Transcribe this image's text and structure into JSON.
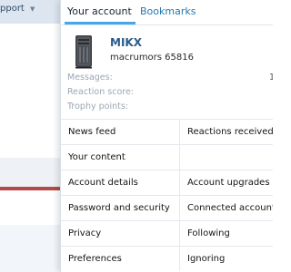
{
  "background": {
    "nav_label": "pport",
    "nav_caret": "▼"
  },
  "tabs": [
    {
      "label": "Your account",
      "active": true
    },
    {
      "label": "Bookmarks",
      "active": false
    }
  ],
  "user": {
    "name": "MIKX",
    "title": "macrumors 65816",
    "avatar": "tower-pc-icon"
  },
  "stats": [
    {
      "label": "Messages:",
      "value": "1"
    },
    {
      "label": "Reaction score:",
      "value": ""
    },
    {
      "label": "Trophy points:",
      "value": ""
    }
  ],
  "grid": [
    {
      "left": "News feed",
      "right": "Reactions received"
    },
    {
      "left": "Your content",
      "right": ""
    },
    {
      "left": "Account details",
      "right": "Account upgrades"
    },
    {
      "left": "Password and security",
      "right": "Connected accounts"
    },
    {
      "left": "Privacy",
      "right": "Following"
    },
    {
      "left": "Preferences",
      "right": "Ignoring"
    }
  ],
  "colors": {
    "accent": "#47a7eb",
    "link": "#2577b1",
    "username": "#2a5a8c",
    "muted": "#9aa7b5",
    "divider": "#e3e8ee",
    "alert": "#b74848"
  }
}
